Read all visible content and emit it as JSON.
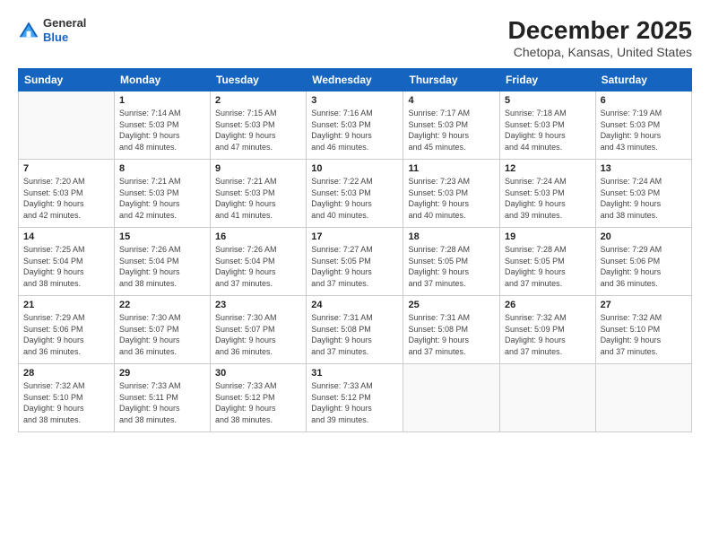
{
  "header": {
    "logo_general": "General",
    "logo_blue": "Blue",
    "title": "December 2025",
    "subtitle": "Chetopa, Kansas, United States"
  },
  "days_of_week": [
    "Sunday",
    "Monday",
    "Tuesday",
    "Wednesday",
    "Thursday",
    "Friday",
    "Saturday"
  ],
  "weeks": [
    [
      {
        "day": "",
        "info": ""
      },
      {
        "day": "1",
        "info": "Sunrise: 7:14 AM\nSunset: 5:03 PM\nDaylight: 9 hours\nand 48 minutes."
      },
      {
        "day": "2",
        "info": "Sunrise: 7:15 AM\nSunset: 5:03 PM\nDaylight: 9 hours\nand 47 minutes."
      },
      {
        "day": "3",
        "info": "Sunrise: 7:16 AM\nSunset: 5:03 PM\nDaylight: 9 hours\nand 46 minutes."
      },
      {
        "day": "4",
        "info": "Sunrise: 7:17 AM\nSunset: 5:03 PM\nDaylight: 9 hours\nand 45 minutes."
      },
      {
        "day": "5",
        "info": "Sunrise: 7:18 AM\nSunset: 5:03 PM\nDaylight: 9 hours\nand 44 minutes."
      },
      {
        "day": "6",
        "info": "Sunrise: 7:19 AM\nSunset: 5:03 PM\nDaylight: 9 hours\nand 43 minutes."
      }
    ],
    [
      {
        "day": "7",
        "info": "Sunrise: 7:20 AM\nSunset: 5:03 PM\nDaylight: 9 hours\nand 42 minutes."
      },
      {
        "day": "8",
        "info": "Sunrise: 7:21 AM\nSunset: 5:03 PM\nDaylight: 9 hours\nand 42 minutes."
      },
      {
        "day": "9",
        "info": "Sunrise: 7:21 AM\nSunset: 5:03 PM\nDaylight: 9 hours\nand 41 minutes."
      },
      {
        "day": "10",
        "info": "Sunrise: 7:22 AM\nSunset: 5:03 PM\nDaylight: 9 hours\nand 40 minutes."
      },
      {
        "day": "11",
        "info": "Sunrise: 7:23 AM\nSunset: 5:03 PM\nDaylight: 9 hours\nand 40 minutes."
      },
      {
        "day": "12",
        "info": "Sunrise: 7:24 AM\nSunset: 5:03 PM\nDaylight: 9 hours\nand 39 minutes."
      },
      {
        "day": "13",
        "info": "Sunrise: 7:24 AM\nSunset: 5:03 PM\nDaylight: 9 hours\nand 38 minutes."
      }
    ],
    [
      {
        "day": "14",
        "info": "Sunrise: 7:25 AM\nSunset: 5:04 PM\nDaylight: 9 hours\nand 38 minutes."
      },
      {
        "day": "15",
        "info": "Sunrise: 7:26 AM\nSunset: 5:04 PM\nDaylight: 9 hours\nand 38 minutes."
      },
      {
        "day": "16",
        "info": "Sunrise: 7:26 AM\nSunset: 5:04 PM\nDaylight: 9 hours\nand 37 minutes."
      },
      {
        "day": "17",
        "info": "Sunrise: 7:27 AM\nSunset: 5:05 PM\nDaylight: 9 hours\nand 37 minutes."
      },
      {
        "day": "18",
        "info": "Sunrise: 7:28 AM\nSunset: 5:05 PM\nDaylight: 9 hours\nand 37 minutes."
      },
      {
        "day": "19",
        "info": "Sunrise: 7:28 AM\nSunset: 5:05 PM\nDaylight: 9 hours\nand 37 minutes."
      },
      {
        "day": "20",
        "info": "Sunrise: 7:29 AM\nSunset: 5:06 PM\nDaylight: 9 hours\nand 36 minutes."
      }
    ],
    [
      {
        "day": "21",
        "info": "Sunrise: 7:29 AM\nSunset: 5:06 PM\nDaylight: 9 hours\nand 36 minutes."
      },
      {
        "day": "22",
        "info": "Sunrise: 7:30 AM\nSunset: 5:07 PM\nDaylight: 9 hours\nand 36 minutes."
      },
      {
        "day": "23",
        "info": "Sunrise: 7:30 AM\nSunset: 5:07 PM\nDaylight: 9 hours\nand 36 minutes."
      },
      {
        "day": "24",
        "info": "Sunrise: 7:31 AM\nSunset: 5:08 PM\nDaylight: 9 hours\nand 37 minutes."
      },
      {
        "day": "25",
        "info": "Sunrise: 7:31 AM\nSunset: 5:08 PM\nDaylight: 9 hours\nand 37 minutes."
      },
      {
        "day": "26",
        "info": "Sunrise: 7:32 AM\nSunset: 5:09 PM\nDaylight: 9 hours\nand 37 minutes."
      },
      {
        "day": "27",
        "info": "Sunrise: 7:32 AM\nSunset: 5:10 PM\nDaylight: 9 hours\nand 37 minutes."
      }
    ],
    [
      {
        "day": "28",
        "info": "Sunrise: 7:32 AM\nSunset: 5:10 PM\nDaylight: 9 hours\nand 38 minutes."
      },
      {
        "day": "29",
        "info": "Sunrise: 7:33 AM\nSunset: 5:11 PM\nDaylight: 9 hours\nand 38 minutes."
      },
      {
        "day": "30",
        "info": "Sunrise: 7:33 AM\nSunset: 5:12 PM\nDaylight: 9 hours\nand 38 minutes."
      },
      {
        "day": "31",
        "info": "Sunrise: 7:33 AM\nSunset: 5:12 PM\nDaylight: 9 hours\nand 39 minutes."
      },
      {
        "day": "",
        "info": ""
      },
      {
        "day": "",
        "info": ""
      },
      {
        "day": "",
        "info": ""
      }
    ]
  ]
}
